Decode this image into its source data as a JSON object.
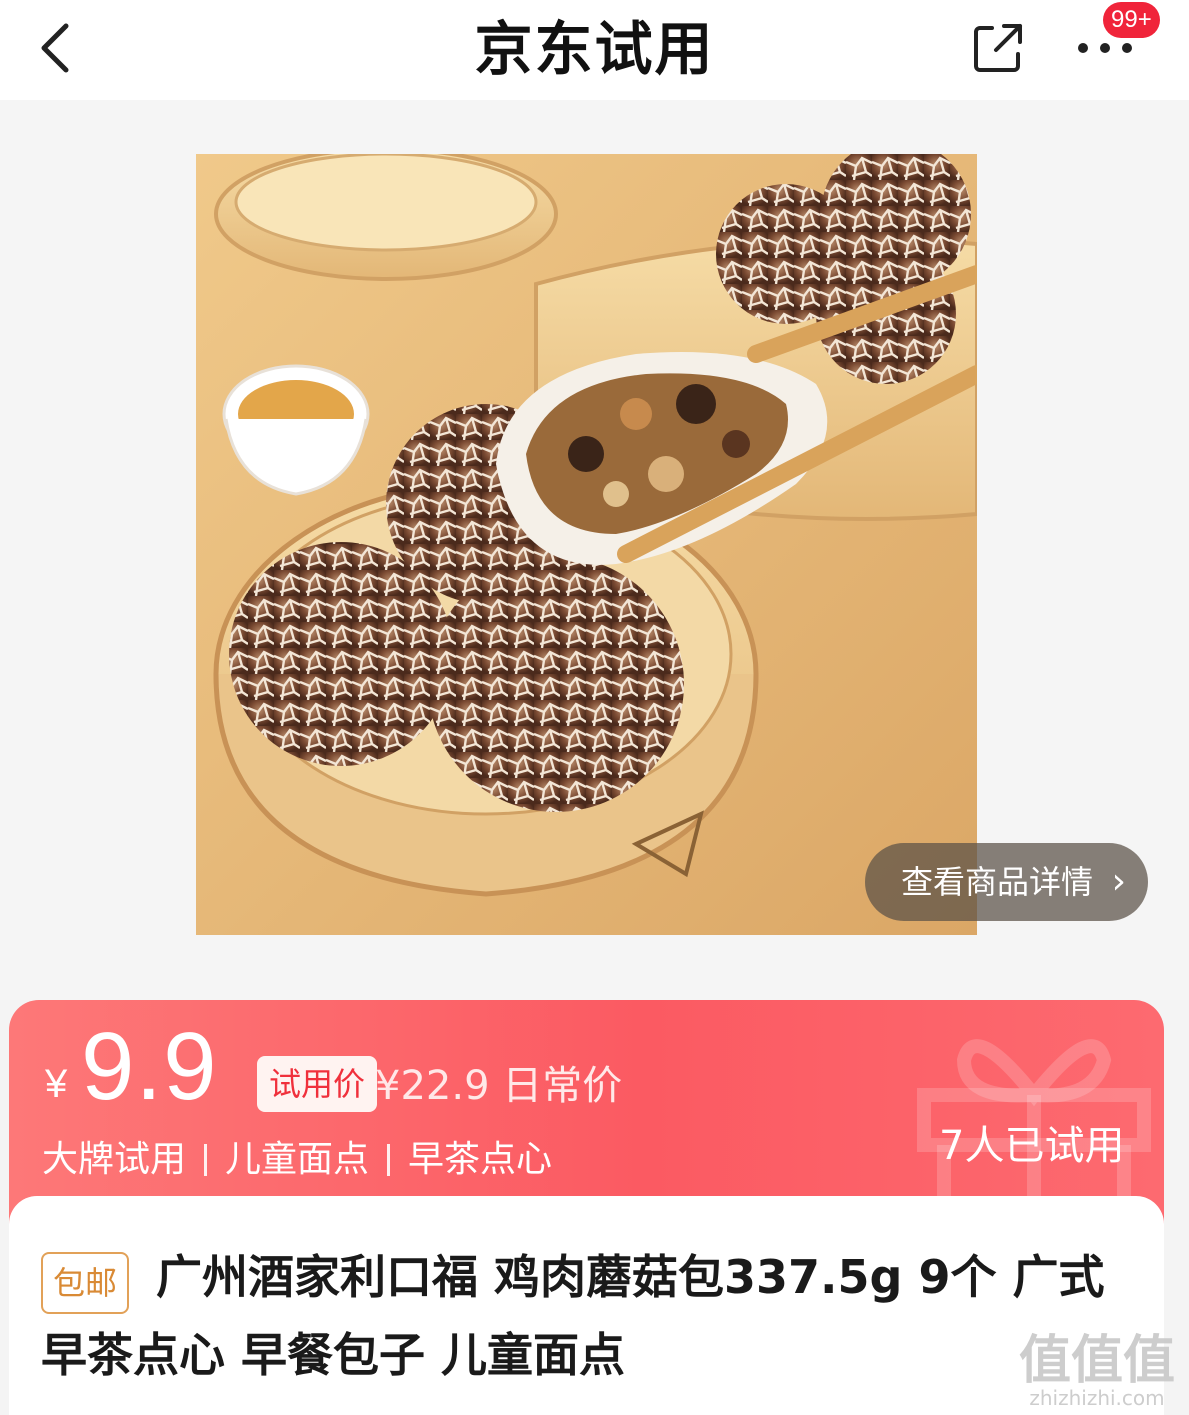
{
  "header": {
    "title": "京东试用",
    "badge_count": "99+"
  },
  "hero": {
    "detail_link_label": "查看商品详情"
  },
  "price_card": {
    "currency": "¥",
    "price": "9.9",
    "trial_tag": "试用价",
    "original_price": "¥22.9 日常价",
    "tags": [
      "大牌试用",
      "儿童面点",
      "早茶点心"
    ],
    "tried_count": "7人已试用"
  },
  "product": {
    "shipping_tag": "包邮",
    "title": "广州酒家利口福 鸡肉蘑菇包337.5g 9个 广式早茶点心 早餐包子 儿童面点"
  },
  "watermark": {
    "text": "值值值",
    "subtext": "zhizhizhi.com"
  },
  "colors": {
    "accent": "#fb5a62",
    "badge": "#f0243a",
    "shipping": "#d98a35"
  }
}
